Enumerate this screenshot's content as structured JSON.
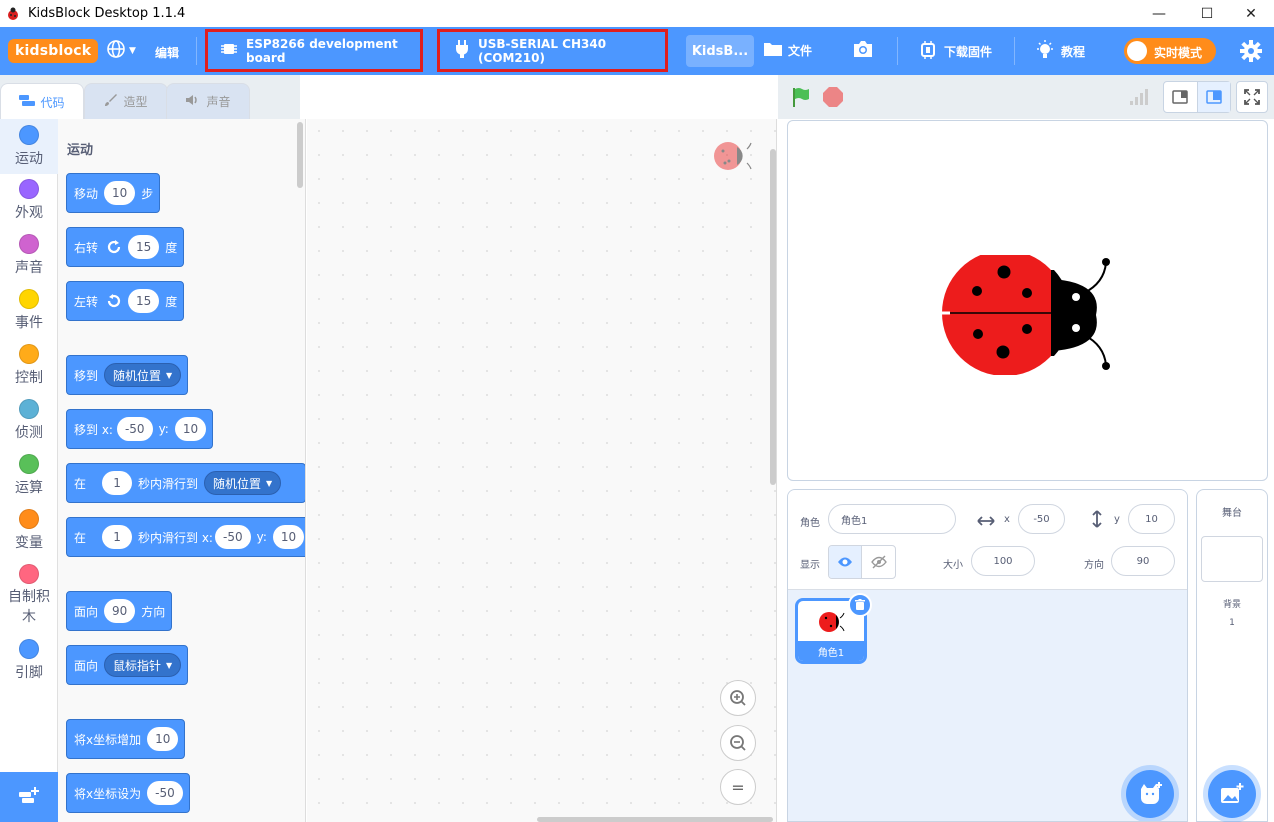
{
  "window": {
    "title": "KidsBlock Desktop 1.1.4",
    "minimize": "—",
    "maximize": "☐",
    "close": "✕"
  },
  "menu": {
    "logo": "kidsblock",
    "edit": "编辑",
    "board": "ESP8266 development board",
    "port": "USB-SERIAL CH340 (COM210)",
    "project_tab": "KidsB...",
    "file": "文件",
    "download_firmware": "下载固件",
    "tutorial": "教程",
    "realtime_mode": "实时模式"
  },
  "tabs": {
    "code": "代码",
    "costume": "造型",
    "sound": "声音"
  },
  "categories": [
    {
      "label": "运动",
      "color": "#4c97ff"
    },
    {
      "label": "外观",
      "color": "#9966ff"
    },
    {
      "label": "声音",
      "color": "#cf63cf"
    },
    {
      "label": "事件",
      "color": "#ffd500"
    },
    {
      "label": "控制",
      "color": "#ffab19"
    },
    {
      "label": "侦测",
      "color": "#5cb1d6"
    },
    {
      "label": "运算",
      "color": "#59c059"
    },
    {
      "label": "变量",
      "color": "#ff8c1a"
    },
    {
      "label": "自制积木",
      "color": "#ff6680"
    },
    {
      "label": "引脚",
      "color": "#4c97ff"
    }
  ],
  "palette": {
    "title": "运动",
    "move": {
      "a": "移动",
      "n": "10",
      "b": "步"
    },
    "turn_right": {
      "a": "右转",
      "n": "15",
      "b": "度"
    },
    "turn_left": {
      "a": "左转",
      "n": "15",
      "b": "度"
    },
    "goto": {
      "a": "移到",
      "dd": "随机位置"
    },
    "goto_xy": {
      "a": "移到 x:",
      "x": "-50",
      "yl": "y:",
      "y": "10"
    },
    "glide": {
      "a": "在",
      "n": "1",
      "b": "秒内滑行到",
      "dd": "随机位置"
    },
    "glide_xy": {
      "a": "在",
      "n": "1",
      "b": "秒内滑行到 x:",
      "x": "-50",
      "yl": "y:",
      "y": "10"
    },
    "point_dir": {
      "a": "面向",
      "n": "90",
      "b": "方向"
    },
    "point_towards": {
      "a": "面向",
      "dd": "鼠标指针"
    },
    "change_x": {
      "a": "将x坐标增加",
      "n": "10"
    },
    "set_x": {
      "a": "将x坐标设为",
      "n": "-50"
    }
  },
  "zoom": {
    "in": "+",
    "out": "−",
    "reset": "="
  },
  "sprite_info": {
    "sprite_label": "角色",
    "sprite_name": "角色1",
    "x_label": "x",
    "x": "-50",
    "y_label": "y",
    "y": "10",
    "show_label": "显示",
    "size_label": "大小",
    "size": "100",
    "direction_label": "方向",
    "direction": "90"
  },
  "sprites": [
    {
      "name": "角色1"
    }
  ],
  "stage_pane": {
    "title": "舞台",
    "backdrops_label": "背景",
    "backdrops_count": "1"
  },
  "colors": {
    "primary": "#4c97ff",
    "orange": "#ff8c1a",
    "highlight": "#e01e1e"
  }
}
